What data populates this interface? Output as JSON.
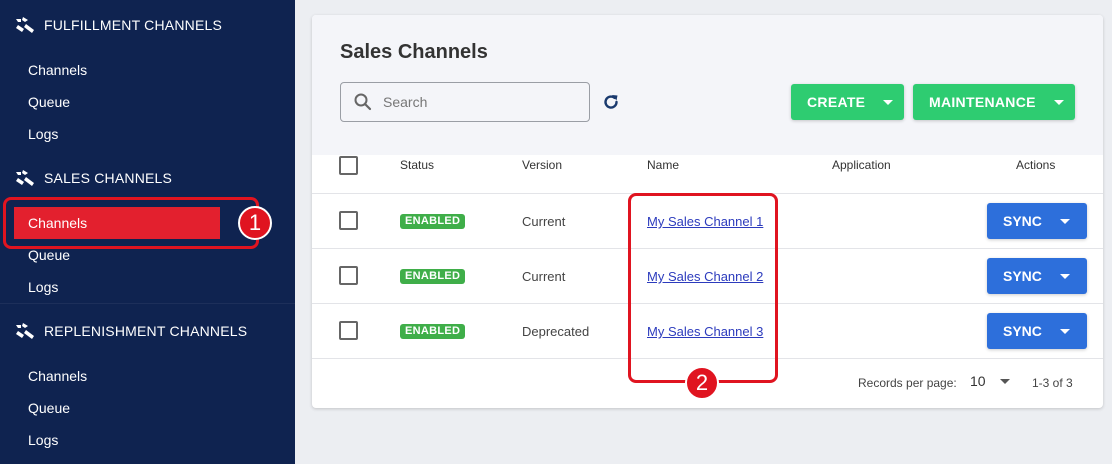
{
  "sidebar": {
    "sections": [
      {
        "title": "FULFILLMENT CHANNELS",
        "icon": "channels-icon",
        "items": [
          "Channels",
          "Queue",
          "Logs"
        ]
      },
      {
        "title": "SALES CHANNELS",
        "icon": "channels-icon",
        "items": [
          "Channels",
          "Queue",
          "Logs"
        ]
      },
      {
        "title": "REPLENISHMENT CHANNELS",
        "icon": "channels-icon",
        "items": [
          "Channels",
          "Queue",
          "Logs"
        ]
      }
    ],
    "colors": {
      "background": "#0f2350",
      "active": "#e3202e"
    }
  },
  "callouts": [
    "1",
    "2"
  ],
  "main": {
    "title": "Sales Channels",
    "search_placeholder": "Search",
    "create_label": "CREATE",
    "maintenance_label": "MAINTENANCE",
    "columns": [
      "Status",
      "Version",
      "Name",
      "Application",
      "Actions"
    ],
    "rows": [
      {
        "status": "ENABLED",
        "version": "Current",
        "name": "My Sales Channel 1",
        "application": "",
        "action": "SYNC"
      },
      {
        "status": "ENABLED",
        "version": "Current",
        "name": "My Sales Channel 2",
        "application": "",
        "action": "SYNC"
      },
      {
        "status": "ENABLED",
        "version": "Deprecated",
        "name": "My Sales Channel 3",
        "application": "",
        "action": "SYNC"
      }
    ],
    "footer": {
      "records_label": "Records per page:",
      "per_page": "10",
      "range": "1-3 of 3"
    },
    "colors": {
      "green": "#2ecc71",
      "blue": "#2d6fdb",
      "badge": "#3fae49",
      "link": "#2c3bbd"
    }
  }
}
